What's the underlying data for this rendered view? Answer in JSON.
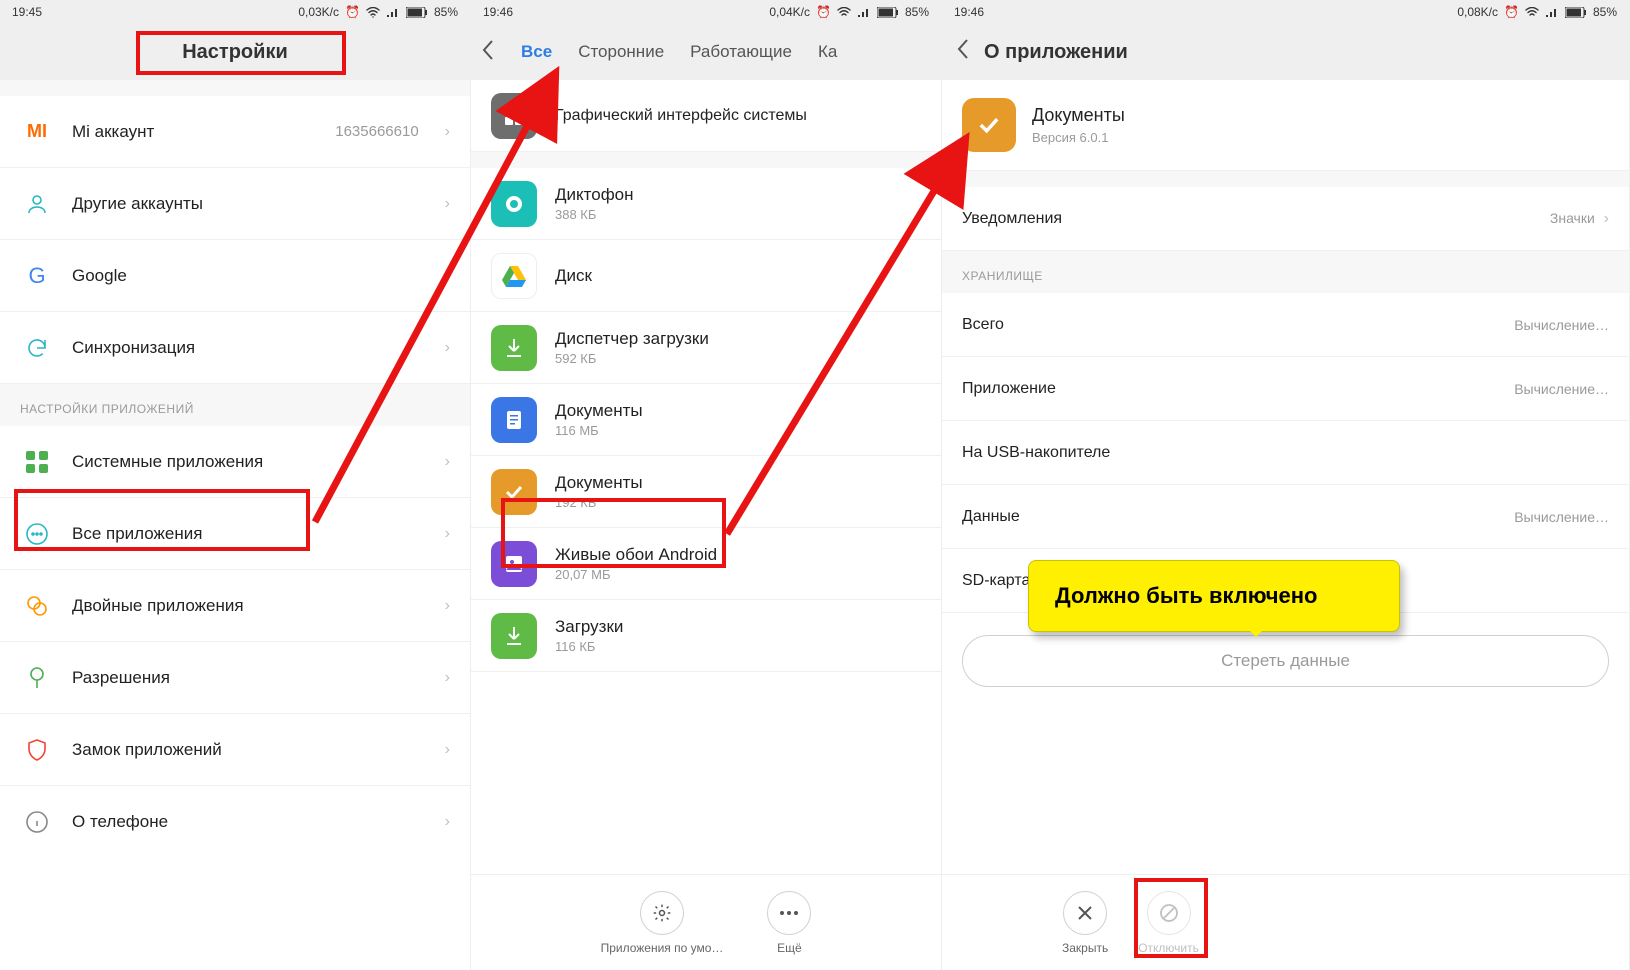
{
  "screens": [
    {
      "status": {
        "time": "19:45",
        "speed": "0,03K/c",
        "battery": "85%"
      },
      "title": "Настройки",
      "accounts": [
        {
          "label": "Mi аккаунт",
          "value": "1635666610",
          "icon": "mi"
        },
        {
          "label": "Другие аккаунты",
          "icon": "person"
        },
        {
          "label": "Google",
          "icon": "google"
        },
        {
          "label": "Синхронизация",
          "icon": "sync"
        }
      ],
      "section": "НАСТРОЙКИ ПРИЛОЖЕНИЙ",
      "app_rows": [
        {
          "label": "Системные приложения",
          "icon": "grid"
        },
        {
          "label": "Все приложения",
          "icon": "dots"
        },
        {
          "label": "Двойные приложения",
          "icon": "dual"
        },
        {
          "label": "Разрешения",
          "icon": "permissions"
        },
        {
          "label": "Замок приложений",
          "icon": "lock"
        },
        {
          "label": "О телефоне",
          "icon": "info"
        }
      ]
    },
    {
      "status": {
        "time": "19:46",
        "speed": "0,04K/c",
        "battery": "85%"
      },
      "tabs": {
        "active": "Все",
        "t2": "Сторонние",
        "t3": "Работающие",
        "t4": "Ка"
      },
      "apps": [
        {
          "name": "Графический интерфейс системы",
          "sub": "",
          "color": "grey",
          "glyph": "⚙"
        },
        {
          "name": "Диктофон",
          "sub": "388 КБ",
          "color": "teal",
          "glyph": "◉"
        },
        {
          "name": "Диск",
          "sub": "",
          "color": "white",
          "glyph": "drive"
        },
        {
          "name": "Диспетчер загрузки",
          "sub": "592 КБ",
          "color": "green",
          "glyph": "↓"
        },
        {
          "name": "Документы",
          "sub": "116 МБ",
          "color": "blue",
          "glyph": "≡"
        },
        {
          "name": "Документы",
          "sub": "192 КБ",
          "color": "orange",
          "glyph": "✓"
        },
        {
          "name": "Живые обои Android",
          "sub": "20,07 МБ",
          "color": "purple",
          "glyph": "▦"
        },
        {
          "name": "Загрузки",
          "sub": "116 КБ",
          "color": "green",
          "glyph": "↓"
        }
      ],
      "bottom": {
        "default": "Приложения по умо…",
        "more": "Ещё"
      }
    },
    {
      "status": {
        "time": "19:46",
        "speed": "0,08K/c",
        "battery": "85%"
      },
      "title": "О приложении",
      "app": {
        "name": "Документы",
        "version": "Версия 6.0.1"
      },
      "notif_label": "Уведомления",
      "notif_val": "Значки",
      "storage_header": "ХРАНИЛИЩЕ",
      "rows": [
        {
          "l": "Всего",
          "v": "Вычисление…"
        },
        {
          "l": "Приложение",
          "v": "Вычисление…"
        },
        {
          "l": "На USB-накопителе",
          "v": ""
        },
        {
          "l": "Данные",
          "v": "Вычисление…"
        },
        {
          "l": "SD-карта",
          "v": ""
        }
      ],
      "erase": "Стереть данные",
      "bottom": {
        "close": "Закрыть",
        "disable": "Отключить"
      },
      "tooltip": "Должно быть включено"
    }
  ]
}
